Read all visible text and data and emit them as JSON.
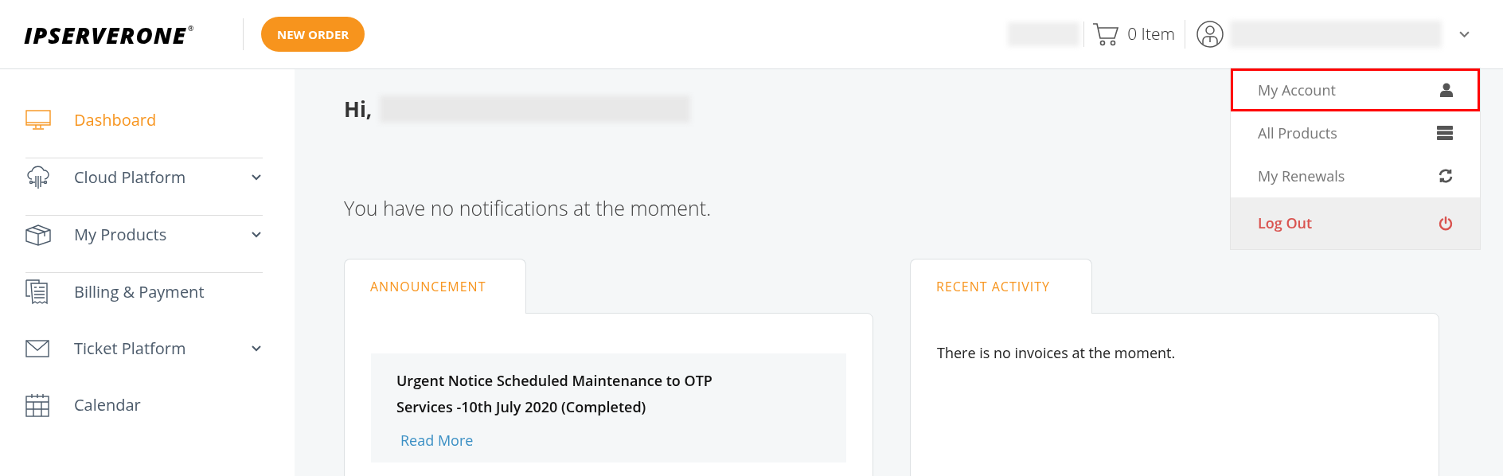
{
  "header": {
    "logo": "IPSERVERONE",
    "logo_mark": "®",
    "new_order": "NEW ORDER",
    "cart": "0 Item"
  },
  "sidebar": {
    "items": [
      {
        "label": "Dashboard",
        "kind": "monitor",
        "selected": true,
        "expandable": false
      },
      {
        "label": "Cloud Platform",
        "kind": "cloud",
        "selected": false,
        "expandable": true
      },
      {
        "label": "My Products",
        "kind": "box",
        "selected": false,
        "expandable": true
      },
      {
        "label": "Billing & Payment",
        "kind": "bill",
        "selected": false,
        "expandable": false
      },
      {
        "label": "Ticket Platform",
        "kind": "mail",
        "selected": false,
        "expandable": true
      },
      {
        "label": "Calendar",
        "kind": "calendar",
        "selected": false,
        "expandable": false
      }
    ]
  },
  "greeting": "Hi,",
  "notifications": "You have no notifications at the moment.",
  "announcement": {
    "tab": "ANNOUNCEMENT",
    "title": "Urgent Notice Scheduled Maintenance to OTP Services -10th July 2020 (Completed)",
    "link": "Read More"
  },
  "recent_activity": {
    "tab": "RECENT ACTIVITY",
    "message": "There is no invoices at the moment."
  },
  "user_menu": {
    "items": [
      {
        "label": "My Account",
        "kind": "user",
        "highlighted": true,
        "danger": false
      },
      {
        "label": "All Products",
        "kind": "server",
        "highlighted": false,
        "danger": false
      },
      {
        "label": "My Renewals",
        "kind": "refresh",
        "highlighted": false,
        "danger": false
      },
      {
        "label": "Log Out",
        "kind": "power",
        "highlighted": false,
        "danger": true
      }
    ]
  }
}
